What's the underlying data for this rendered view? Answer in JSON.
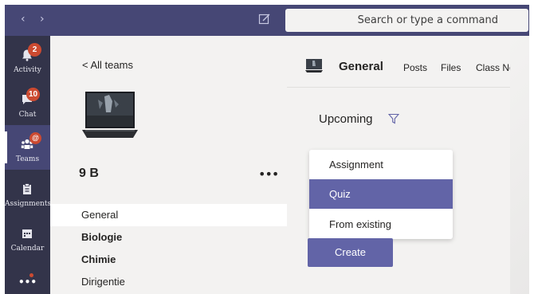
{
  "topbar": {
    "back_arrow": "‹",
    "forward_arrow": "›",
    "search_placeholder": "Search or type a command"
  },
  "rail": {
    "items": [
      {
        "label": "Activity",
        "badge": "2"
      },
      {
        "label": "Chat",
        "badge": "10"
      },
      {
        "label": "Teams",
        "badge": "@"
      },
      {
        "label": "Assignments"
      },
      {
        "label": "Calendar"
      },
      {
        "label": "•••"
      }
    ]
  },
  "team": {
    "back_label": "<  All teams",
    "name": "9 B",
    "more": "•••",
    "channels": [
      "General",
      "Biologie",
      "Chimie",
      "Dirigentie"
    ]
  },
  "main": {
    "channel_title": "General",
    "tabs": [
      "Posts",
      "Files",
      "Class Note"
    ],
    "section_label": "Upcoming",
    "menu_items": [
      "Assignment",
      "Quiz",
      "From existing"
    ],
    "create_label": "Create"
  },
  "colors": {
    "brand_purple": "#6264a7",
    "topbar": "#464775",
    "rail": "#33344a",
    "badge": "#cc4a31"
  }
}
